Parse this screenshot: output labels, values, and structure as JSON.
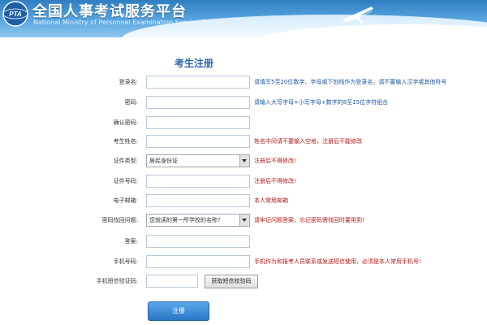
{
  "header": {
    "title": "全国人事考试服务平台",
    "subtitle": "National Ministry of Personnel Examination Service Platform",
    "logo_icon": "pta-logo-icon",
    "plane_icon": "airplane-icon"
  },
  "form": {
    "title": "考生注册",
    "rows": [
      {
        "label": "登录名:",
        "hint": "请填写5至20位数字、字母或下划线作为登录名，请不要输入汉字或其他符号",
        "hint_color": "blue"
      },
      {
        "label": "密码:",
        "hint": "请输入大写字母+小写字母+数字的8至15位字符组合",
        "hint_color": "blue"
      },
      {
        "label": "确认密码:",
        "hint": ""
      },
      {
        "label": "考生姓名:",
        "hint": "姓名中间请不要输入空格，注册后不能修改",
        "hint_color": "red"
      },
      {
        "label": "证件类型:",
        "select_value": "居民身份证",
        "hint": "注册后不得修改!",
        "hint_color": "red"
      },
      {
        "label": "证件号码:",
        "hint": "注册后不得修改!",
        "hint_color": "red"
      },
      {
        "label": "电子邮箱:",
        "hint": "本人常用邮箱",
        "hint_color": "red"
      },
      {
        "label": "密码找回问题:",
        "select_value": "您就读的第一所学校的名称?",
        "hint": "请牢记问题答案，忘记密码需找回时要用到!",
        "hint_color": "red"
      },
      {
        "label": "答案:",
        "hint": ""
      },
      {
        "label": "手机号码:",
        "hint": "手机作为和报考人员联系或发送短信使用，必须是本人常用手机号!",
        "hint_color": "red"
      },
      {
        "label": "手机短信验证码:",
        "button": "获取短信校验码"
      }
    ],
    "submit_label": "注册"
  },
  "colors": {
    "header_blue": "#2f7ec2",
    "title_blue": "#2a63a8",
    "hint_blue": "#1e55a0",
    "hint_red": "#b01818",
    "button_blue": "#2a76c6"
  }
}
